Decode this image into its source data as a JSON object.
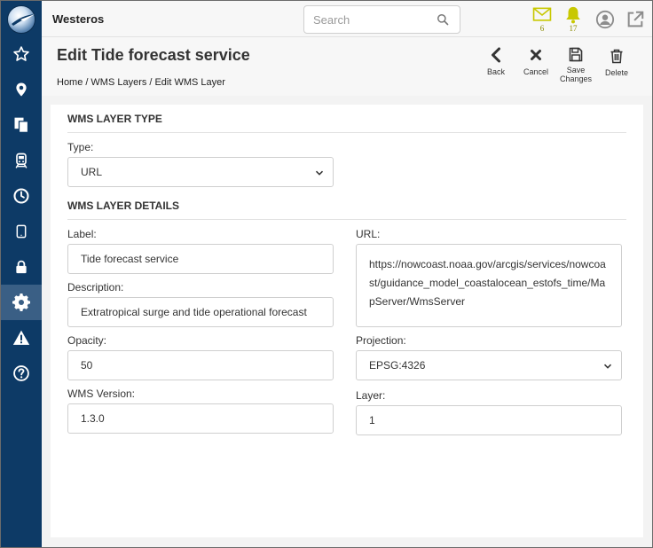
{
  "app": {
    "title": "Westeros"
  },
  "search": {
    "placeholder": "Search"
  },
  "notifications": {
    "messages_count": "6",
    "alerts_count": "17"
  },
  "page": {
    "title": "Edit Tide forecast service"
  },
  "breadcrumb": [
    "Home",
    "WMS Layers",
    "Edit WMS Layer"
  ],
  "actions": {
    "back": "Back",
    "cancel": "Cancel",
    "save": [
      "Save",
      "Changes"
    ],
    "delete": "Delete"
  },
  "sections": {
    "type": "WMS LAYER TYPE",
    "details": "WMS LAYER DETAILS"
  },
  "form": {
    "type_label": "Type:",
    "type_value": "URL",
    "label_label": "Label:",
    "label_value": "Tide forecast service",
    "description_label": "Description:",
    "description_value": "Extratropical surge and tide operational forecast",
    "opacity_label": "Opacity:",
    "opacity_value": "50",
    "wms_version_label": "WMS Version:",
    "wms_version_value": "1.3.0",
    "url_label": "URL:",
    "url_value": "https://nowcoast.noaa.gov/arcgis/services/nowcoast/guidance_model_coastalocean_estofs_time/MapServer/WmsServer",
    "projection_label": "Projection:",
    "projection_value": "EPSG:4326",
    "layer_label": "Layer:",
    "layer_value": "1"
  },
  "sidebar": {
    "items": [
      {
        "icon": "star-icon"
      },
      {
        "icon": "map-marker-icon"
      },
      {
        "icon": "documents-icon"
      },
      {
        "icon": "train-icon"
      },
      {
        "icon": "clock-icon"
      },
      {
        "icon": "tablet-icon"
      },
      {
        "icon": "lock-icon"
      },
      {
        "icon": "gear-icon",
        "active": true
      },
      {
        "icon": "warning-icon"
      },
      {
        "icon": "help-icon"
      }
    ]
  },
  "colors": {
    "sidebar": "#0d3a66",
    "sidebar_active": "#3a5f85",
    "notify": "#c8c800"
  }
}
